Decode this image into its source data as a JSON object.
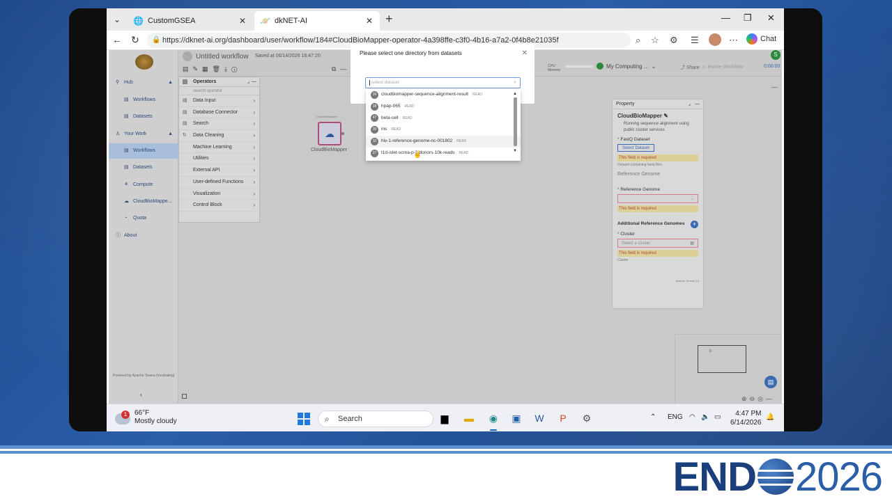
{
  "browser": {
    "tabs": [
      {
        "label": "CustomGSEA"
      },
      {
        "label": "dkNET-AI"
      }
    ],
    "url": "https://dknet-ai.org/dashboard/user/workflow/184#CloudBioMapper-operator-4a398ffe-c3f0-4b16-a7a2-0f4b8e21035f",
    "chat_label": "Chat"
  },
  "app": {
    "workflow_title": "Untitled workflow",
    "saved_text": "Saved at 06/14/2026 16:47:20",
    "cpu_label": "CPU",
    "memory_label": "Memory",
    "computing_unit": "My Computing ...",
    "share_label": "Share",
    "invoke_label": "Invoke Workflow",
    "timer": "0:00:00",
    "user_initial": "S"
  },
  "sidebar": {
    "items": [
      {
        "label": "Hub",
        "icon": "hub-icon"
      },
      {
        "label": "Workflows",
        "icon": "workflow-icon"
      },
      {
        "label": "Datasets",
        "icon": "dataset-icon"
      },
      {
        "label": "Your Work",
        "icon": "user-icon"
      },
      {
        "label": "Workflows",
        "icon": "workflow-icon"
      },
      {
        "label": "Datasets",
        "icon": "dataset-icon"
      },
      {
        "label": "Compute",
        "icon": "compute-icon"
      },
      {
        "label": "CloudBioMappe...",
        "icon": "cloud-icon"
      },
      {
        "label": "Quota",
        "icon": "quota-icon"
      },
      {
        "label": "About",
        "icon": "info-icon"
      }
    ],
    "footer": "Powered by Apache Texera (Incubating)"
  },
  "operators": {
    "header": "Operators",
    "search_placeholder": "search operator",
    "items": [
      "Data Input",
      "Database Connector",
      "Search",
      "Data Cleaning",
      "Machine Learning",
      "Utilities",
      "External API",
      "User-defined Functions",
      "Visualization",
      "Control Block"
    ]
  },
  "node": {
    "label": "CloudBioMapper",
    "top_label": "CloudBioMapper"
  },
  "property": {
    "header": "Property",
    "name": "CloudBioMapper",
    "description": "Running sequence alignment using public cluster services",
    "fastq_label": "FastQ Dataset",
    "select_dataset_button": "Select Dataset",
    "required": "This field is required",
    "fastq_hint": "Dataset containing fastq files",
    "ref_section": "Reference Genome",
    "ref_label": "Reference Genome",
    "additional_label": "Additional Reference Genomes",
    "cluster_label": "Cluster",
    "cluster_placeholder": "Select a cluster",
    "cluster_hint": "Cluster",
    "footer": "Apache Texera 2.0"
  },
  "modal": {
    "title": "Please select one directory from datasets",
    "input_placeholder": "select dataset",
    "datasets": [
      {
        "id": "26",
        "name": "cloudbiomapper-sequence-alignment-result",
        "access": "READ"
      },
      {
        "id": "28",
        "name": "hpap-065",
        "access": "READ"
      },
      {
        "id": "47",
        "name": "beta-cell",
        "access": "READ"
      },
      {
        "id": "30",
        "name": "ins",
        "access": "READ"
      },
      {
        "id": "32",
        "name": "hiv-1-reference-genome-nc-001802",
        "access": "READ"
      },
      {
        "id": "27",
        "name": "t1d-islet-scrna-p-2-donors-10k-reads",
        "access": "READ"
      }
    ]
  },
  "minimap": {
    "marker": "0"
  },
  "taskbar": {
    "temp": "66°F",
    "condition": "Mostly cloudy",
    "weather_badge": "1",
    "search_label": "Search",
    "lang": "ENG",
    "time": "4:47 PM",
    "date": "6/14/2026"
  },
  "branding": {
    "part1": "END",
    "part2": "2026",
    "colors": {
      "dark": "#1a3f7c",
      "light": "#2a5ea8"
    }
  }
}
